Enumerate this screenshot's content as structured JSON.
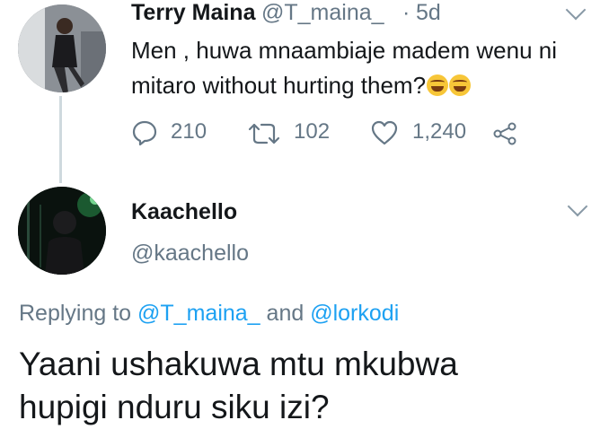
{
  "tweet": {
    "author_name": "Terry Maina",
    "author_handle": "@T_maina_",
    "separator": "·",
    "time": "5d",
    "text": "Men , huwa mnaambiaje madem wenu ni mitaro without hurting them?",
    "emoji": [
      "face-with-tears-of-joy",
      "face-with-tears-of-joy"
    ],
    "actions": {
      "reply_count": "210",
      "retweet_count": "102",
      "like_count": "1,240"
    }
  },
  "reply": {
    "author_name": "Kaachello",
    "author_handle": "@kaachello",
    "replying_prefix": "Replying to",
    "replying_to_1": "@T_maina_",
    "replying_and": "and",
    "replying_to_2": "@lorkodi",
    "text_line1": "Yaani ushakuwa mtu mkubwa",
    "text_line2": "hupigi nduru siku izi?"
  },
  "colors": {
    "text": "#14171a",
    "secondary": "#657786",
    "link": "#1da1f2",
    "divider": "#cfd9de"
  }
}
